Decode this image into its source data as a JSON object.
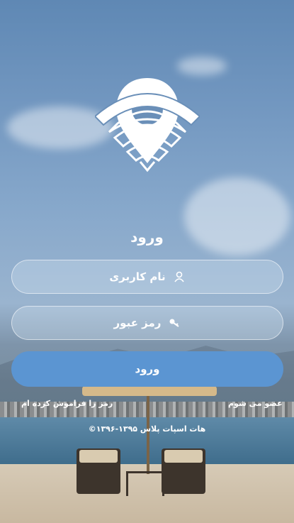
{
  "login": {
    "title": "ورود",
    "username_placeholder": "نام کاربری",
    "password_placeholder": "رمز عبور",
    "submit_label": "ورود"
  },
  "links": {
    "signup": "عضو می شوم",
    "forgot": "رمز را فراموش کرده ام"
  },
  "footer": {
    "copyright": "©۱۳۹۶-۱۳۹۵ هات اسپات پلاس"
  },
  "colors": {
    "primary_button": "#5b95d2",
    "text": "#ffffff"
  },
  "icons": {
    "logo": "location-wifi-logo",
    "username": "user-icon",
    "password": "key-icon"
  }
}
